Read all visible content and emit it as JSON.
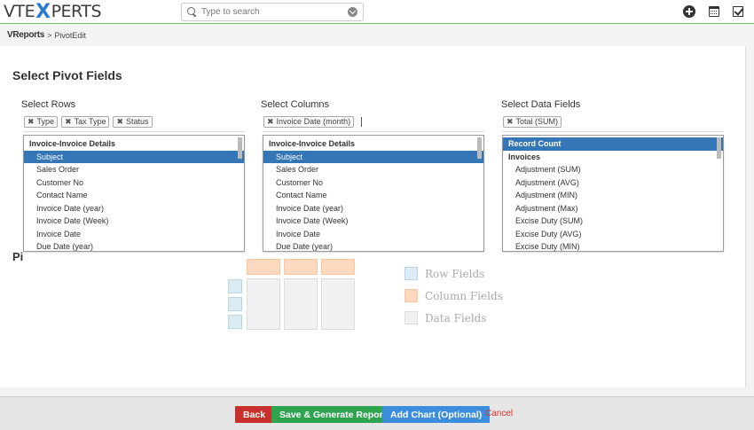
{
  "header": {
    "logo_left": "VTE",
    "logo_x": "X",
    "logo_right": "PERTS",
    "search_placeholder": "Type to search",
    "icons": [
      "plus-icon",
      "calendar-icon",
      "check-icon"
    ]
  },
  "breadcrumb": {
    "module": "VReports",
    "separator": ">",
    "page": "PivotEdit"
  },
  "main": {
    "title": "Select Pivot Fields",
    "obscured_heading": "Pi",
    "rows": {
      "label": "Select Rows",
      "tags": [
        "Type",
        "Tax Type",
        "Status"
      ],
      "items": [
        {
          "label": "Invoice-Invoice Details",
          "group": true,
          "selected": false
        },
        {
          "label": "Subject",
          "group": false,
          "selected": true
        },
        {
          "label": "Sales Order",
          "group": false,
          "selected": false
        },
        {
          "label": "Customer No",
          "group": false,
          "selected": false
        },
        {
          "label": "Contact Name",
          "group": false,
          "selected": false
        },
        {
          "label": "Invoice Date (year)",
          "group": false,
          "selected": false
        },
        {
          "label": "Invoice Date (Week)",
          "group": false,
          "selected": false
        },
        {
          "label": "Invoice Date",
          "group": false,
          "selected": false
        },
        {
          "label": "Due Date (year)",
          "group": false,
          "selected": false
        }
      ]
    },
    "columns": {
      "label": "Select Columns",
      "tags": [
        "Invoice Date (month)"
      ],
      "items": [
        {
          "label": "Invoice-Invoice Details",
          "group": true,
          "selected": false
        },
        {
          "label": "Subject",
          "group": false,
          "selected": true
        },
        {
          "label": "Sales Order",
          "group": false,
          "selected": false
        },
        {
          "label": "Customer No",
          "group": false,
          "selected": false
        },
        {
          "label": "Contact Name",
          "group": false,
          "selected": false
        },
        {
          "label": "Invoice Date (year)",
          "group": false,
          "selected": false
        },
        {
          "label": "Invoice Date (Week)",
          "group": false,
          "selected": false
        },
        {
          "label": "Invoice Date",
          "group": false,
          "selected": false
        },
        {
          "label": "Due Date (year)",
          "group": false,
          "selected": false
        }
      ]
    },
    "data_fields": {
      "label": "Select Data Fields",
      "tags": [
        "Total (SUM)"
      ],
      "items": [
        {
          "label": "Record Count",
          "group": true,
          "selected": true
        },
        {
          "label": "Invoices",
          "group": true,
          "selected": false
        },
        {
          "label": "Adjustment (SUM)",
          "group": false,
          "selected": false
        },
        {
          "label": "Adjustment (AVG)",
          "group": false,
          "selected": false
        },
        {
          "label": "Adjustment (MIN)",
          "group": false,
          "selected": false
        },
        {
          "label": "Adjustment (Max)",
          "group": false,
          "selected": false
        },
        {
          "label": "Excise Duty (SUM)",
          "group": false,
          "selected": false
        },
        {
          "label": "Excise Duty (AVG)",
          "group": false,
          "selected": false
        },
        {
          "label": "Excise Duty (MIN)",
          "group": false,
          "selected": false
        }
      ]
    },
    "legend": {
      "row_fields": "Row Fields",
      "column_fields": "Column Fields",
      "data_fields": "Data Fields"
    },
    "colors": {
      "selected": "#3576b6",
      "column_box": "#fcd9bf",
      "row_box": "#dcecf7",
      "data_box": "#f1f1f1"
    }
  },
  "footer": {
    "back": "Back",
    "save": "Save & Generate Report",
    "add_chart": "Add Chart (Optional)",
    "cancel": "Cancel"
  }
}
